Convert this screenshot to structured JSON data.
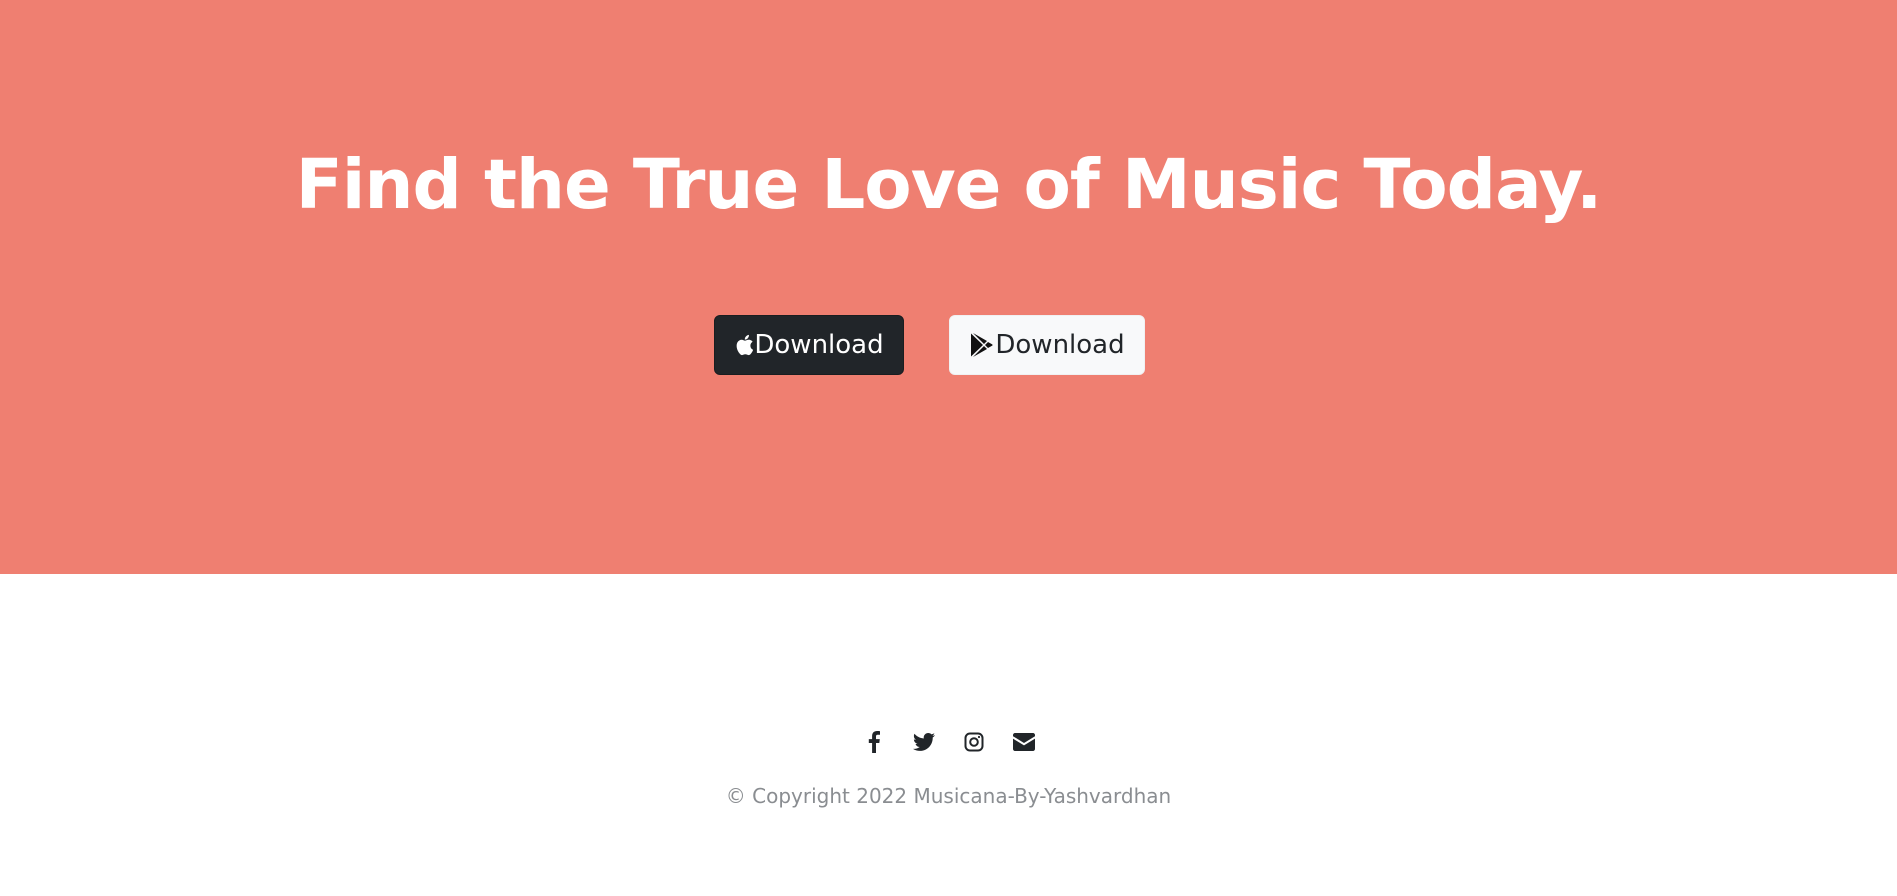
{
  "hero": {
    "title": "Find the True Love of Music Today.",
    "background_color": "#ef7f71",
    "buttons": [
      {
        "label": "Download",
        "icon": "apple-icon",
        "style": "dark"
      },
      {
        "label": "Download",
        "icon": "google-play-icon",
        "style": "light"
      }
    ]
  },
  "footer": {
    "social_icons": [
      "facebook-icon",
      "twitter-icon",
      "instagram-icon",
      "envelope-icon"
    ],
    "copyright": "© Copyright 2022 Musicana-By-Yashvardhan"
  },
  "colors": {
    "dark_button": "#212529",
    "light_button": "#f8f9fa",
    "text_muted": "#8a8d91"
  }
}
